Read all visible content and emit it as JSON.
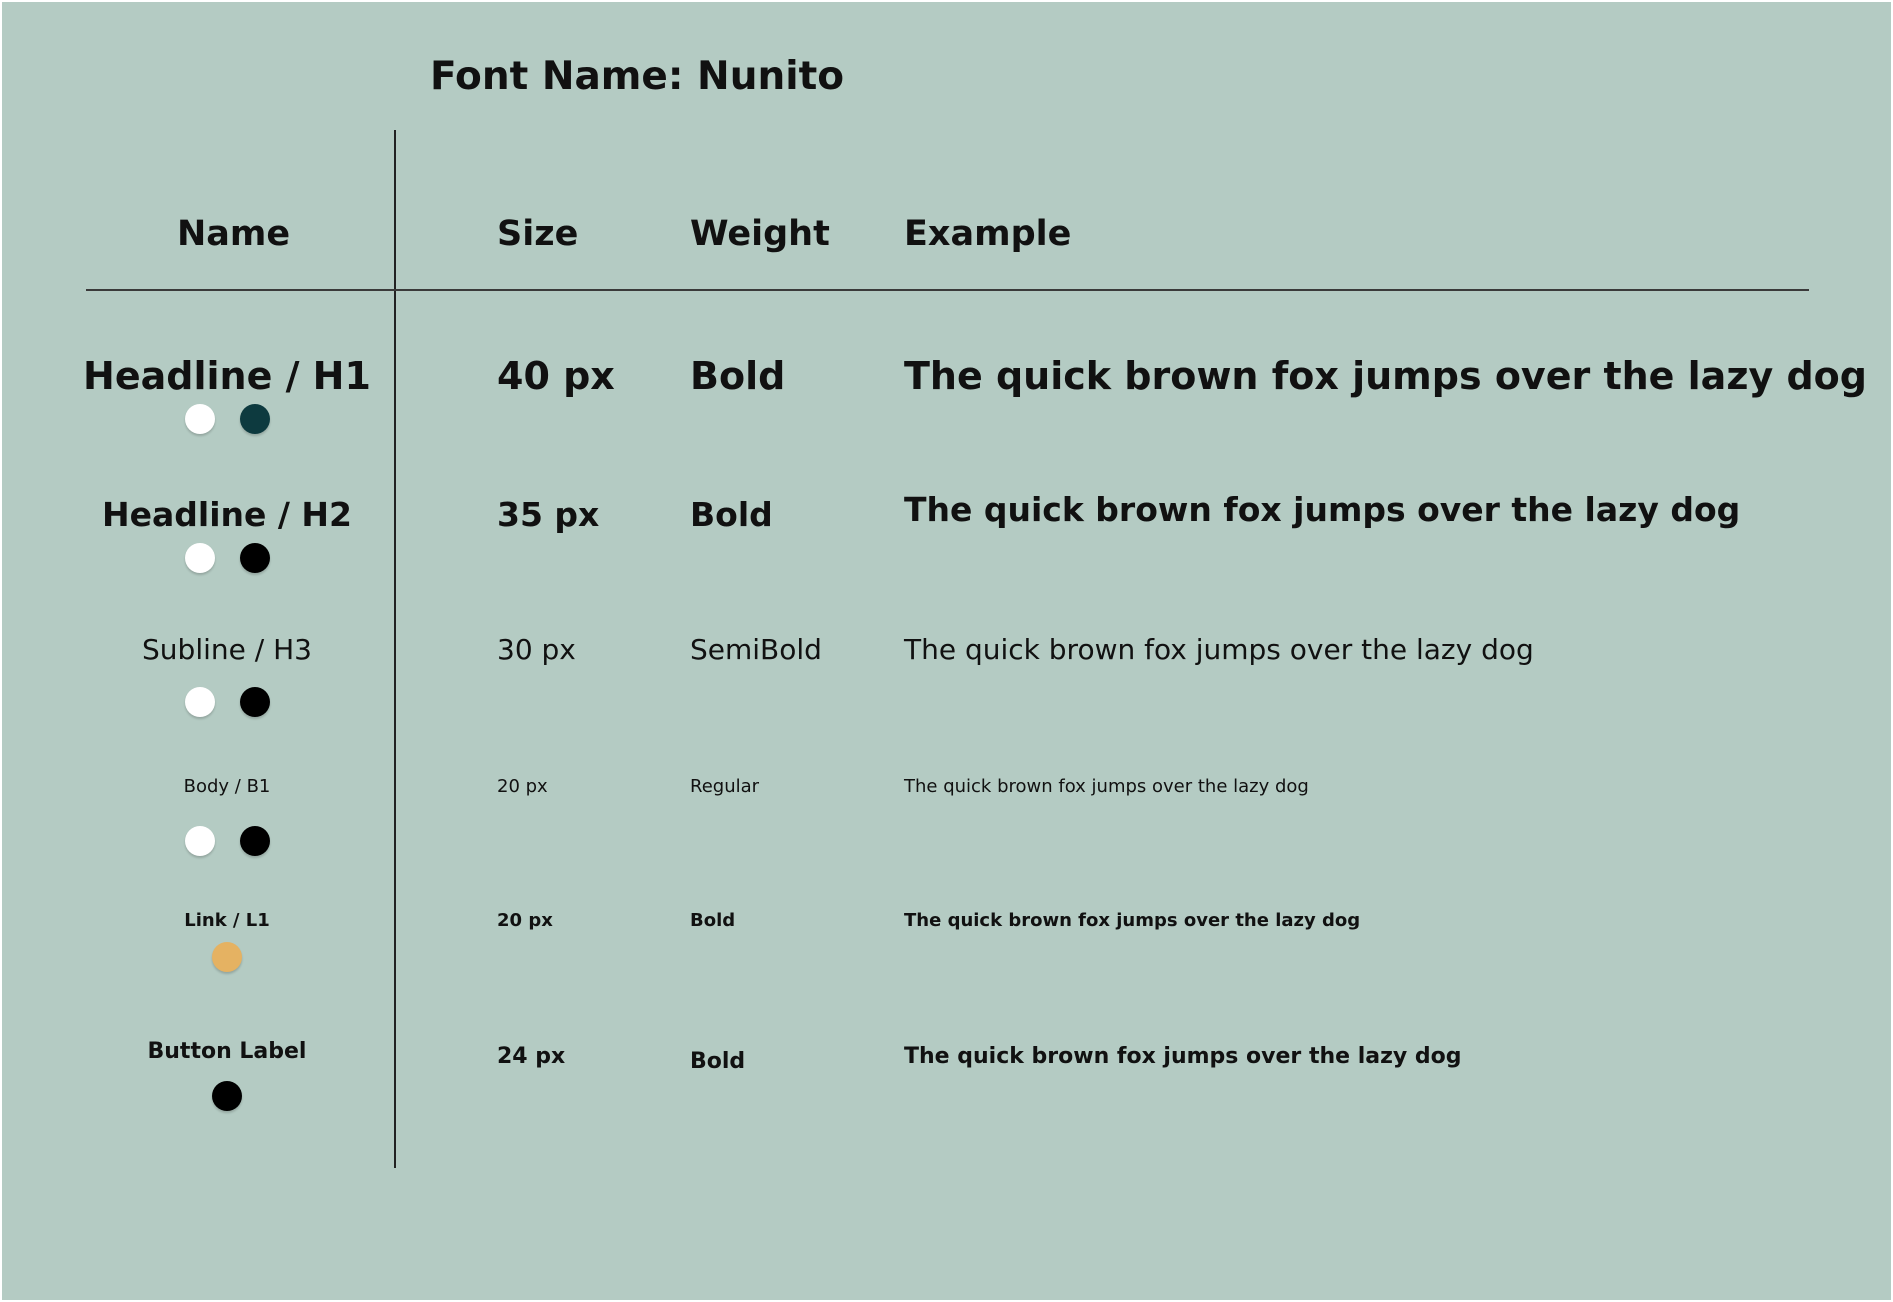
{
  "title": "Font Name: Nunito",
  "headers": {
    "name": "Name",
    "size": "Size",
    "weight": "Weight",
    "example": "Example"
  },
  "rows": [
    {
      "name": "Headline / H1",
      "size": "40 px",
      "weight": "Bold",
      "example": "The  quick brown fox jumps over the lazy dog",
      "colors": [
        "#ffffff",
        "#0d3a3f"
      ]
    },
    {
      "name": "Headline / H2",
      "size": "35 px",
      "weight": "Bold",
      "example": "The  quick brown fox jumps over the lazy dog",
      "colors": [
        "#ffffff",
        "#000000"
      ]
    },
    {
      "name": "Subline / H3",
      "size": "30 px",
      "weight": "SemiBold",
      "example": "The  quick brown fox jumps over the lazy dog",
      "colors": [
        "#ffffff",
        "#000000"
      ]
    },
    {
      "name": "Body / B1",
      "size": "20 px",
      "weight": "Regular",
      "example": "The  quick brown fox jumps over the lazy dog",
      "colors": [
        "#ffffff",
        "#000000"
      ]
    },
    {
      "name": "Link / L1",
      "size": "20 px",
      "weight": "Bold",
      "example": "The  quick brown fox jumps over the lazy dog",
      "colors": [
        "#e5b262"
      ]
    },
    {
      "name": "Button Label",
      "size": "24 px",
      "weight": "Bold",
      "example": "The  quick brown fox jumps over the lazy dog",
      "colors": [
        "#000000"
      ]
    }
  ]
}
